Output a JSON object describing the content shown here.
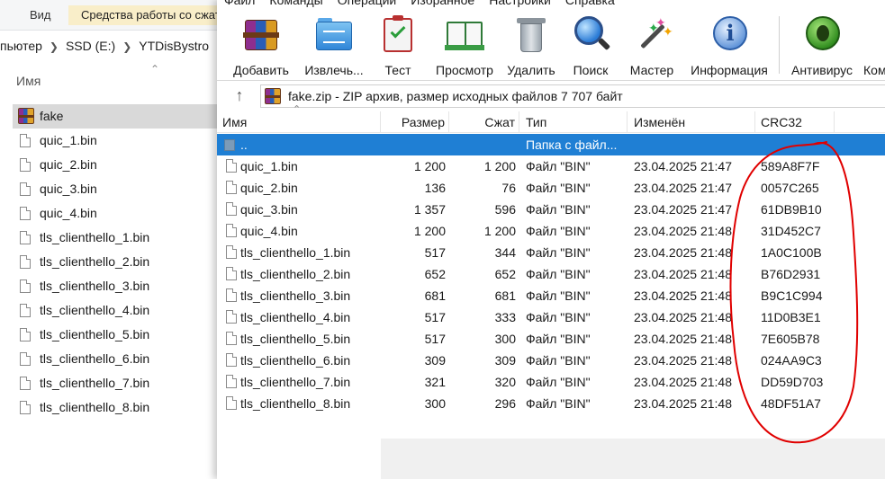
{
  "explorer": {
    "tab_view": "Вид",
    "tab_tools": "Средства работы со сжатыми",
    "breadcrumb": [
      "пьютер",
      "SSD (E:)",
      "YTDisBystro"
    ],
    "column_name": "Имя",
    "items": [
      {
        "name": "fake",
        "selected": true,
        "icon": "winrar-archive-icon"
      },
      {
        "name": "quic_1.bin"
      },
      {
        "name": "quic_2.bin"
      },
      {
        "name": "quic_3.bin"
      },
      {
        "name": "quic_4.bin"
      },
      {
        "name": "tls_clienthello_1.bin"
      },
      {
        "name": "tls_clienthello_2.bin"
      },
      {
        "name": "tls_clienthello_3.bin"
      },
      {
        "name": "tls_clienthello_4.bin"
      },
      {
        "name": "tls_clienthello_5.bin"
      },
      {
        "name": "tls_clienthello_6.bin"
      },
      {
        "name": "tls_clienthello_7.bin"
      },
      {
        "name": "tls_clienthello_8.bin"
      }
    ]
  },
  "winrar": {
    "menu": [
      "Файл",
      "Команды",
      "Операции",
      "Избранное",
      "Настройки",
      "Справка"
    ],
    "toolbar": [
      {
        "label": "Добавить",
        "icon": "add-archive-icon"
      },
      {
        "label": "Извлечь...",
        "icon": "extract-folder-icon"
      },
      {
        "label": "Тест",
        "icon": "test-clipboard-icon"
      },
      {
        "label": "Просмотр",
        "icon": "view-book-icon"
      },
      {
        "label": "Удалить",
        "icon": "delete-trash-icon"
      },
      {
        "label": "Поиск",
        "icon": "find-magnifier-icon"
      },
      {
        "label": "Мастер",
        "icon": "wizard-wand-icon"
      },
      {
        "label": "Информация",
        "icon": "info-icon"
      },
      {
        "label": "Антивирус",
        "icon": "antivirus-icon"
      },
      {
        "label": "Ком",
        "icon": "comment-icon"
      }
    ],
    "path": "fake.zip - ZIP архив, размер исходных файлов 7 707 байт",
    "columns": {
      "name": "Имя",
      "size": "Размер",
      "packed": "Сжат",
      "type": "Тип",
      "modified": "Изменён",
      "crc": "CRC32"
    },
    "rows": [
      {
        "name": "..",
        "size": "",
        "packed": "",
        "type": "Папка с файл...",
        "modified": "",
        "crc": "",
        "selected": true
      },
      {
        "name": "quic_1.bin",
        "size": "1 200",
        "packed": "1 200",
        "type": "Файл \"BIN\"",
        "modified": "23.04.2025 21:47",
        "crc": "589A8F7F"
      },
      {
        "name": "quic_2.bin",
        "size": "136",
        "packed": "76",
        "type": "Файл \"BIN\"",
        "modified": "23.04.2025 21:47",
        "crc": "0057C265"
      },
      {
        "name": "quic_3.bin",
        "size": "1 357",
        "packed": "596",
        "type": "Файл \"BIN\"",
        "modified": "23.04.2025 21:47",
        "crc": "61DB9B10"
      },
      {
        "name": "quic_4.bin",
        "size": "1 200",
        "packed": "1 200",
        "type": "Файл \"BIN\"",
        "modified": "23.04.2025 21:48",
        "crc": "31D452C7"
      },
      {
        "name": "tls_clienthello_1.bin",
        "size": "517",
        "packed": "344",
        "type": "Файл \"BIN\"",
        "modified": "23.04.2025 21:48",
        "crc": "1A0C100B"
      },
      {
        "name": "tls_clienthello_2.bin",
        "size": "652",
        "packed": "652",
        "type": "Файл \"BIN\"",
        "modified": "23.04.2025 21:48",
        "crc": "B76D2931"
      },
      {
        "name": "tls_clienthello_3.bin",
        "size": "681",
        "packed": "681",
        "type": "Файл \"BIN\"",
        "modified": "23.04.2025 21:48",
        "crc": "B9C1C994"
      },
      {
        "name": "tls_clienthello_4.bin",
        "size": "517",
        "packed": "333",
        "type": "Файл \"BIN\"",
        "modified": "23.04.2025 21:48",
        "crc": "11D0B3E1"
      },
      {
        "name": "tls_clienthello_5.bin",
        "size": "517",
        "packed": "300",
        "type": "Файл \"BIN\"",
        "modified": "23.04.2025 21:48",
        "crc": "7E605B78"
      },
      {
        "name": "tls_clienthello_6.bin",
        "size": "309",
        "packed": "309",
        "type": "Файл \"BIN\"",
        "modified": "23.04.2025 21:48",
        "crc": "024AA9C3"
      },
      {
        "name": "tls_clienthello_7.bin",
        "size": "321",
        "packed": "320",
        "type": "Файл \"BIN\"",
        "modified": "23.04.2025 21:48",
        "crc": "DD59D703"
      },
      {
        "name": "tls_clienthello_8.bin",
        "size": "300",
        "packed": "296",
        "type": "Файл \"BIN\"",
        "modified": "23.04.2025 21:48",
        "crc": "48DF51A7"
      }
    ],
    "colors": {
      "selection": "#1f7fd4",
      "annotation": "#e00000"
    }
  }
}
